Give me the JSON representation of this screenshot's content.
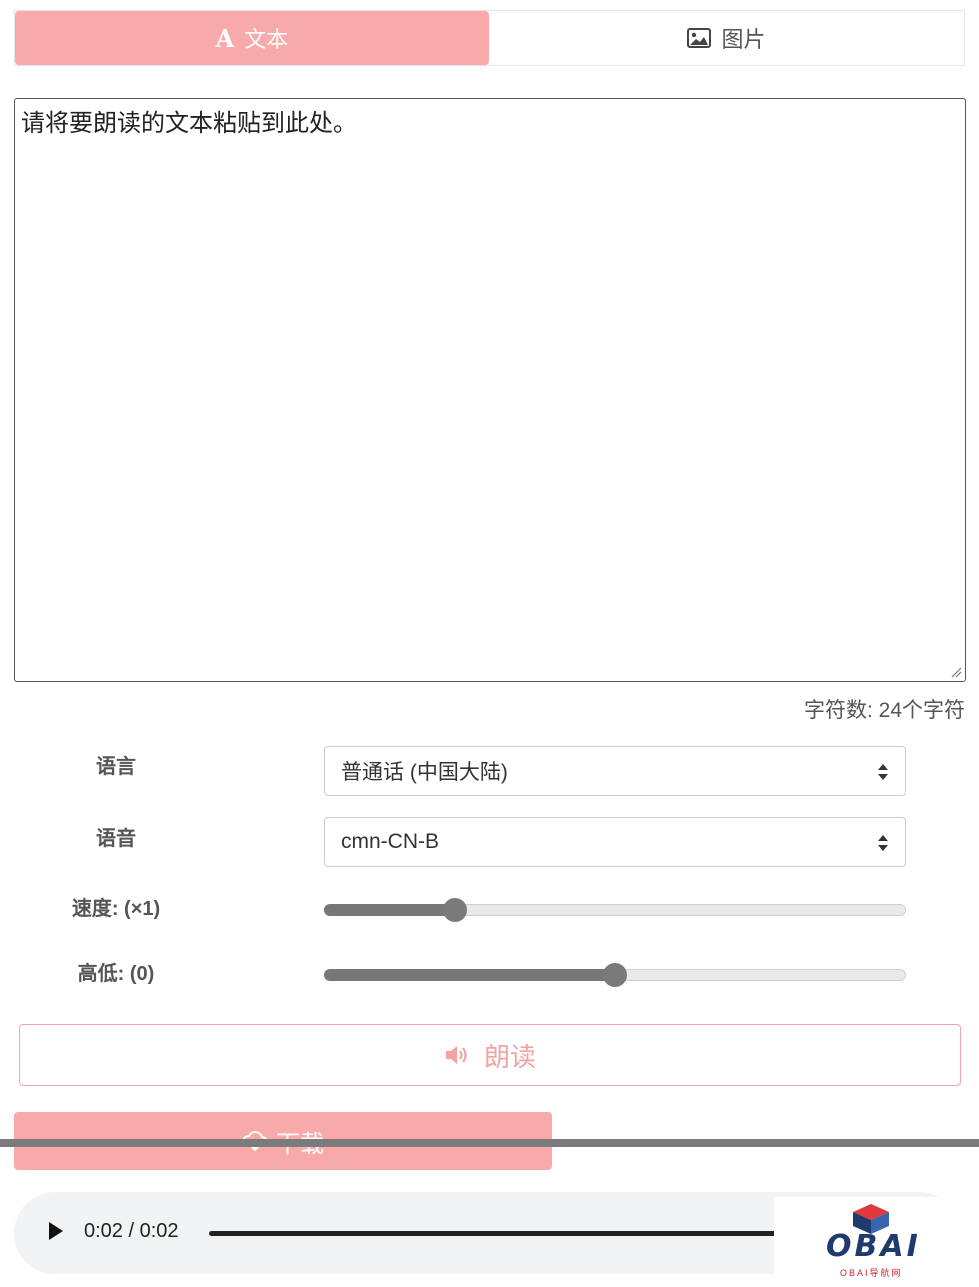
{
  "tabs": [
    {
      "icon": "font-a-icon",
      "label": "文本",
      "active": true
    },
    {
      "icon": "image-icon",
      "label": "图片",
      "active": false
    }
  ],
  "textarea": {
    "value": "请将要朗读的文本粘贴到此处。"
  },
  "char_count": "字符数:  24个字符",
  "controls": {
    "language": {
      "label": "语言",
      "value": "普通话 (中国大陆)"
    },
    "voice": {
      "label": "语音",
      "value": "cmn-CN-B"
    },
    "speed": {
      "label": "速度: (×1)",
      "level_fraction": 0.225
    },
    "pitch": {
      "label": "高低: (0)",
      "level_fraction": 0.5
    }
  },
  "buttons": {
    "read": {
      "label": "朗读",
      "icon": "speaker-icon"
    },
    "download": {
      "label": "下载",
      "icon": "cloud-download-icon"
    }
  },
  "audio": {
    "time": "0:02 / 0:02",
    "progress_fraction": 1.0
  },
  "logo": {
    "text": "OBAI",
    "subtitle": "OBAI导航网"
  },
  "colors": {
    "accent": "#f8aaaa",
    "slider": "#777777"
  }
}
